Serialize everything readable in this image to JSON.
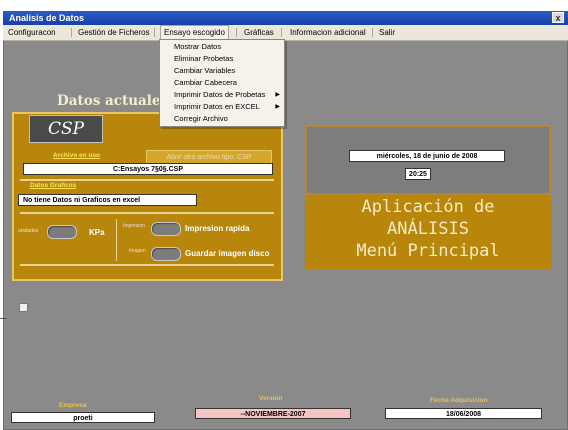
{
  "window": {
    "title": "Analisis de Datos",
    "close_glyph": "x"
  },
  "menu": {
    "items": [
      "Configuracon",
      "Gestión de Ficheros",
      "Ensayo escogido",
      "Gráficas",
      "Informacion adicional",
      "Salir"
    ],
    "open_item_index": 2
  },
  "dropdown": {
    "items": [
      {
        "label": "Mostrar Datos",
        "submenu": false
      },
      {
        "label": "Eliminar Probetas",
        "submenu": false
      },
      {
        "label": "Cambiar Variables",
        "submenu": false
      },
      {
        "label": "Cambiar Cabecera",
        "submenu": false
      },
      {
        "label": "Imprimir Datos de Probetas",
        "submenu": true
      },
      {
        "label": "Imprimir Datos en EXCEL",
        "submenu": true
      },
      {
        "label": "Corregir Archivo",
        "submenu": false
      }
    ],
    "submenu_glyph": "▶"
  },
  "left_panel": {
    "heading": "Datos actuales en",
    "logo_text": "CSP",
    "open_button": "Abrir otro archivo tipo: CSP",
    "archivo_label": "Archivo en uso",
    "archivo_value": "C:Ensayos 7§0§.CSP",
    "graficos_label": "Datos Graficos",
    "graficos_value": "No tiene Datos ni Graficos en excel",
    "units_label": "unidades",
    "units_value": "KPa",
    "impresion_small": "Impresion",
    "impresion_label": "Impresion rapida",
    "imagen_small": "Imagen",
    "imagen_label": "Guardar imagen disco"
  },
  "right_panel": {
    "date": "miércoles, 18 de junio de 2008",
    "time": "20:25",
    "title_lines": [
      "Aplicación de",
      "ANÁLISIS",
      "Menú Principal"
    ]
  },
  "footer": {
    "empresa_label": "Empresa",
    "empresa_value": "proeti",
    "version_label": "Version",
    "version_value": "--NOVIEMBRE-2007",
    "fecha_label": "Fecha Adquisicion",
    "fecha_value": "18/06/2008"
  },
  "colors": {
    "accent_gold": "#b8860b",
    "window_gray": "#8a8a8a",
    "version_box": "#f7c4c4"
  }
}
